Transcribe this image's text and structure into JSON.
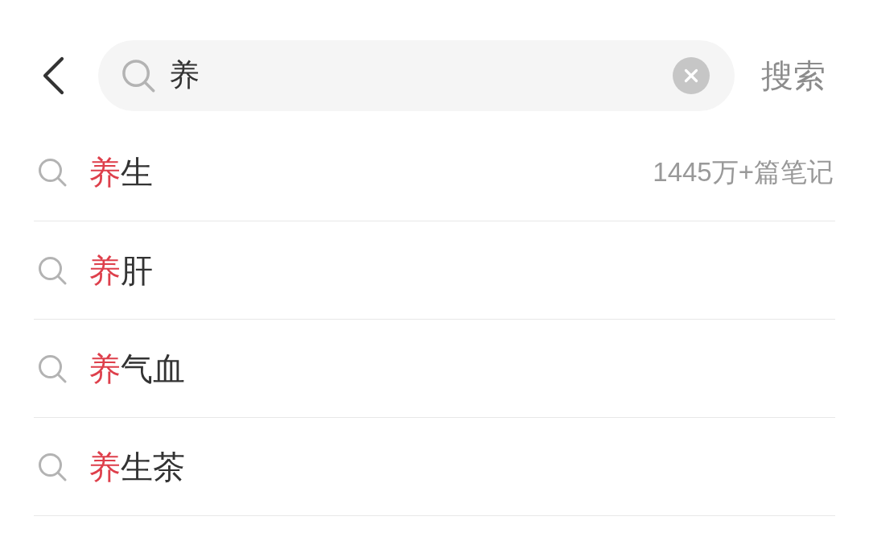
{
  "search_bar": {
    "search_field": {
      "value": "养"
    },
    "search_button": "搜索"
  },
  "suggestions": [
    {
      "parts": [
        {
          "text": "养",
          "highlighted": true
        },
        {
          "text": "生",
          "highlighted": false
        }
      ],
      "note_count": "1445万+篇笔记"
    },
    {
      "parts": [
        {
          "text": "养",
          "highlighted": true
        },
        {
          "text": "肝",
          "highlighted": false
        }
      ]
    },
    {
      "parts": [
        {
          "text": "养",
          "highlighted": true
        },
        {
          "text": "气血",
          "highlighted": false
        }
      ]
    },
    {
      "parts": [
        {
          "text": "养",
          "highlighted": true
        },
        {
          "text": "生茶",
          "highlighted": false
        }
      ]
    }
  ]
}
